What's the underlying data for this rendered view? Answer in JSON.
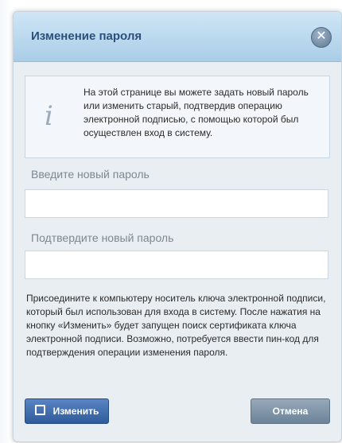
{
  "dialog": {
    "title": "Изменение пароля",
    "close_icon": "close-icon",
    "info_icon": "info-icon",
    "info_glyph": "i",
    "info_text": "На этой странице вы можете задать новый пароль или изменить старый, подтвердив операцию электронной подписью, с помощью которой был осуществлен вход в систему.",
    "new_password_label": "Введите новый пароль",
    "confirm_password_label": "Подтвердите новый пароль",
    "instructions": "Присоедините к компьютеру носитель ключа электронной подписи, который был использован для входа в систему. После нажатия на кнопку «Изменить» будет запущен поиск сертификата ключа электронной подписи. Возможно, потребуется ввести пин-код для подтверждения операции изменения пароля.",
    "change_button": "Изменить",
    "cancel_button": "Отмена",
    "close_glyph": "✕"
  },
  "colors": {
    "title_bar": "#b6d6ee",
    "title_text": "#2c4f7c",
    "primary_button": "#2f5c9c",
    "secondary_button": "#7f94a8"
  }
}
